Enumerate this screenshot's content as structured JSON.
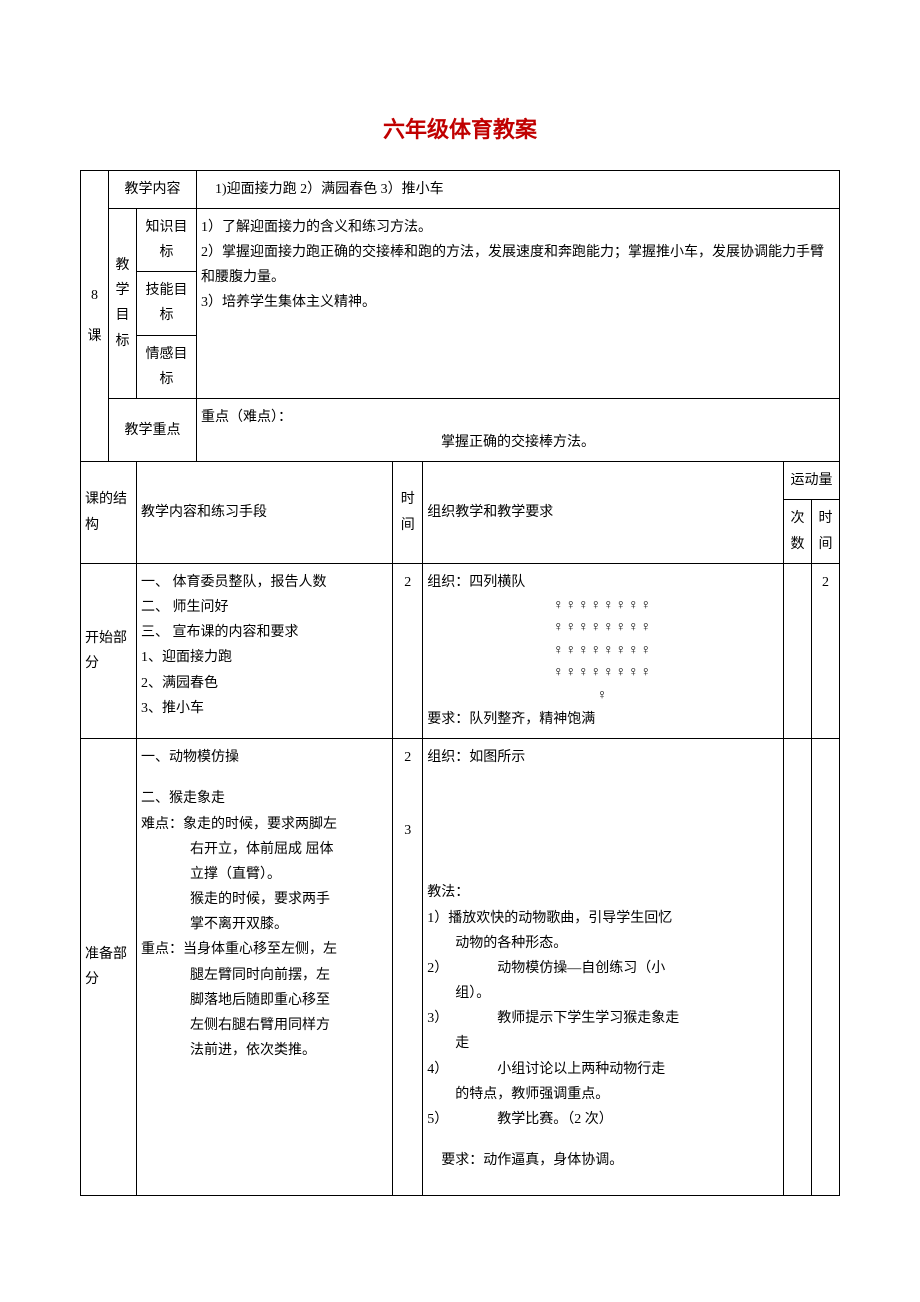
{
  "title": "六年级体育教案",
  "header": {
    "lessonNumLine1": "8",
    "lessonNumLine2": "课",
    "contentLabel": "教学内容",
    "contentText": "1)迎面接力跑 2）满园春色 3）推小车",
    "objLabel": "教学目标",
    "obj1Label": "知识目标",
    "obj2Label": "技能目标",
    "obj3Label": "情感目标",
    "obj1Text": "1）了解迎面接力的含义和练习方法。",
    "obj2Text": "2）掌握迎面接力跑正确的交接棒和跑的方法，发展速度和奔跑能力；掌握推小车，发展协调能力手臂和腰腹力量。",
    "obj3Text": "3）培养学生集体主义精神。",
    "keyLabel": "教学重点",
    "keyText1": "重点（难点）：",
    "keyText2": "掌握正确的交接棒方法。"
  },
  "columns": {
    "c1": "课的结构",
    "c2": "教学内容和练习手段",
    "c3": "时间",
    "c4": "组织教学和教学要求",
    "c5": "运动量",
    "c5a": "次数",
    "c5b": "时间"
  },
  "part1": {
    "name": "开始部分",
    "contentL1": "一、 体育委员整队，报告人数",
    "contentL2": "二、 师生问好",
    "contentL3": "三、 宣布课的内容和要求",
    "contentL4": "1、迎面接力跑",
    "contentL5": "2、满园春色",
    "contentL6": "3、推小车",
    "time": "2",
    "orgTitle": "组织：四列横队",
    "formationRow": "♀♀♀♀♀♀♀♀",
    "formationTeacher": "♀",
    "orgReq": "要求：队列整齐，精神饱满",
    "loadTime": "2"
  },
  "part2": {
    "name": "准备部分",
    "contentL1": "一、动物模仿操",
    "contentL2": "二、猴走象走",
    "contentL3": "难点：象走的时候，要求两脚左右开立，体前屈成 屈体立撑（直臂）。",
    "contentL4": "猴走的时候，要求两手掌不离开双膝。",
    "contentL5": "重点：当身体重心移至左侧，左腿左臂同时向前摆，左脚落地后随即重心移至左侧右腿右臂用同样方法前进，依次类推。",
    "time1": "2",
    "time2": "3",
    "orgTitle": "组织：如图所示",
    "methodTitle": "教法：",
    "method1": "1）播放欢快的动物歌曲，引导学生回忆动物的各种形态。",
    "method2a": "2）",
    "method2b": "动物模仿操—自创练习（小组）。",
    "method3a": "3）",
    "method3b": "教师提示下学生学习猴走象走",
    "method4a": "4）",
    "method4b": "小组讨论以上两种动物行走的特点，教师强调重点。",
    "method5a": "5）",
    "method5b": "教学比赛。（2 次）",
    "req": "要求：动作逼真，身体协调。"
  }
}
